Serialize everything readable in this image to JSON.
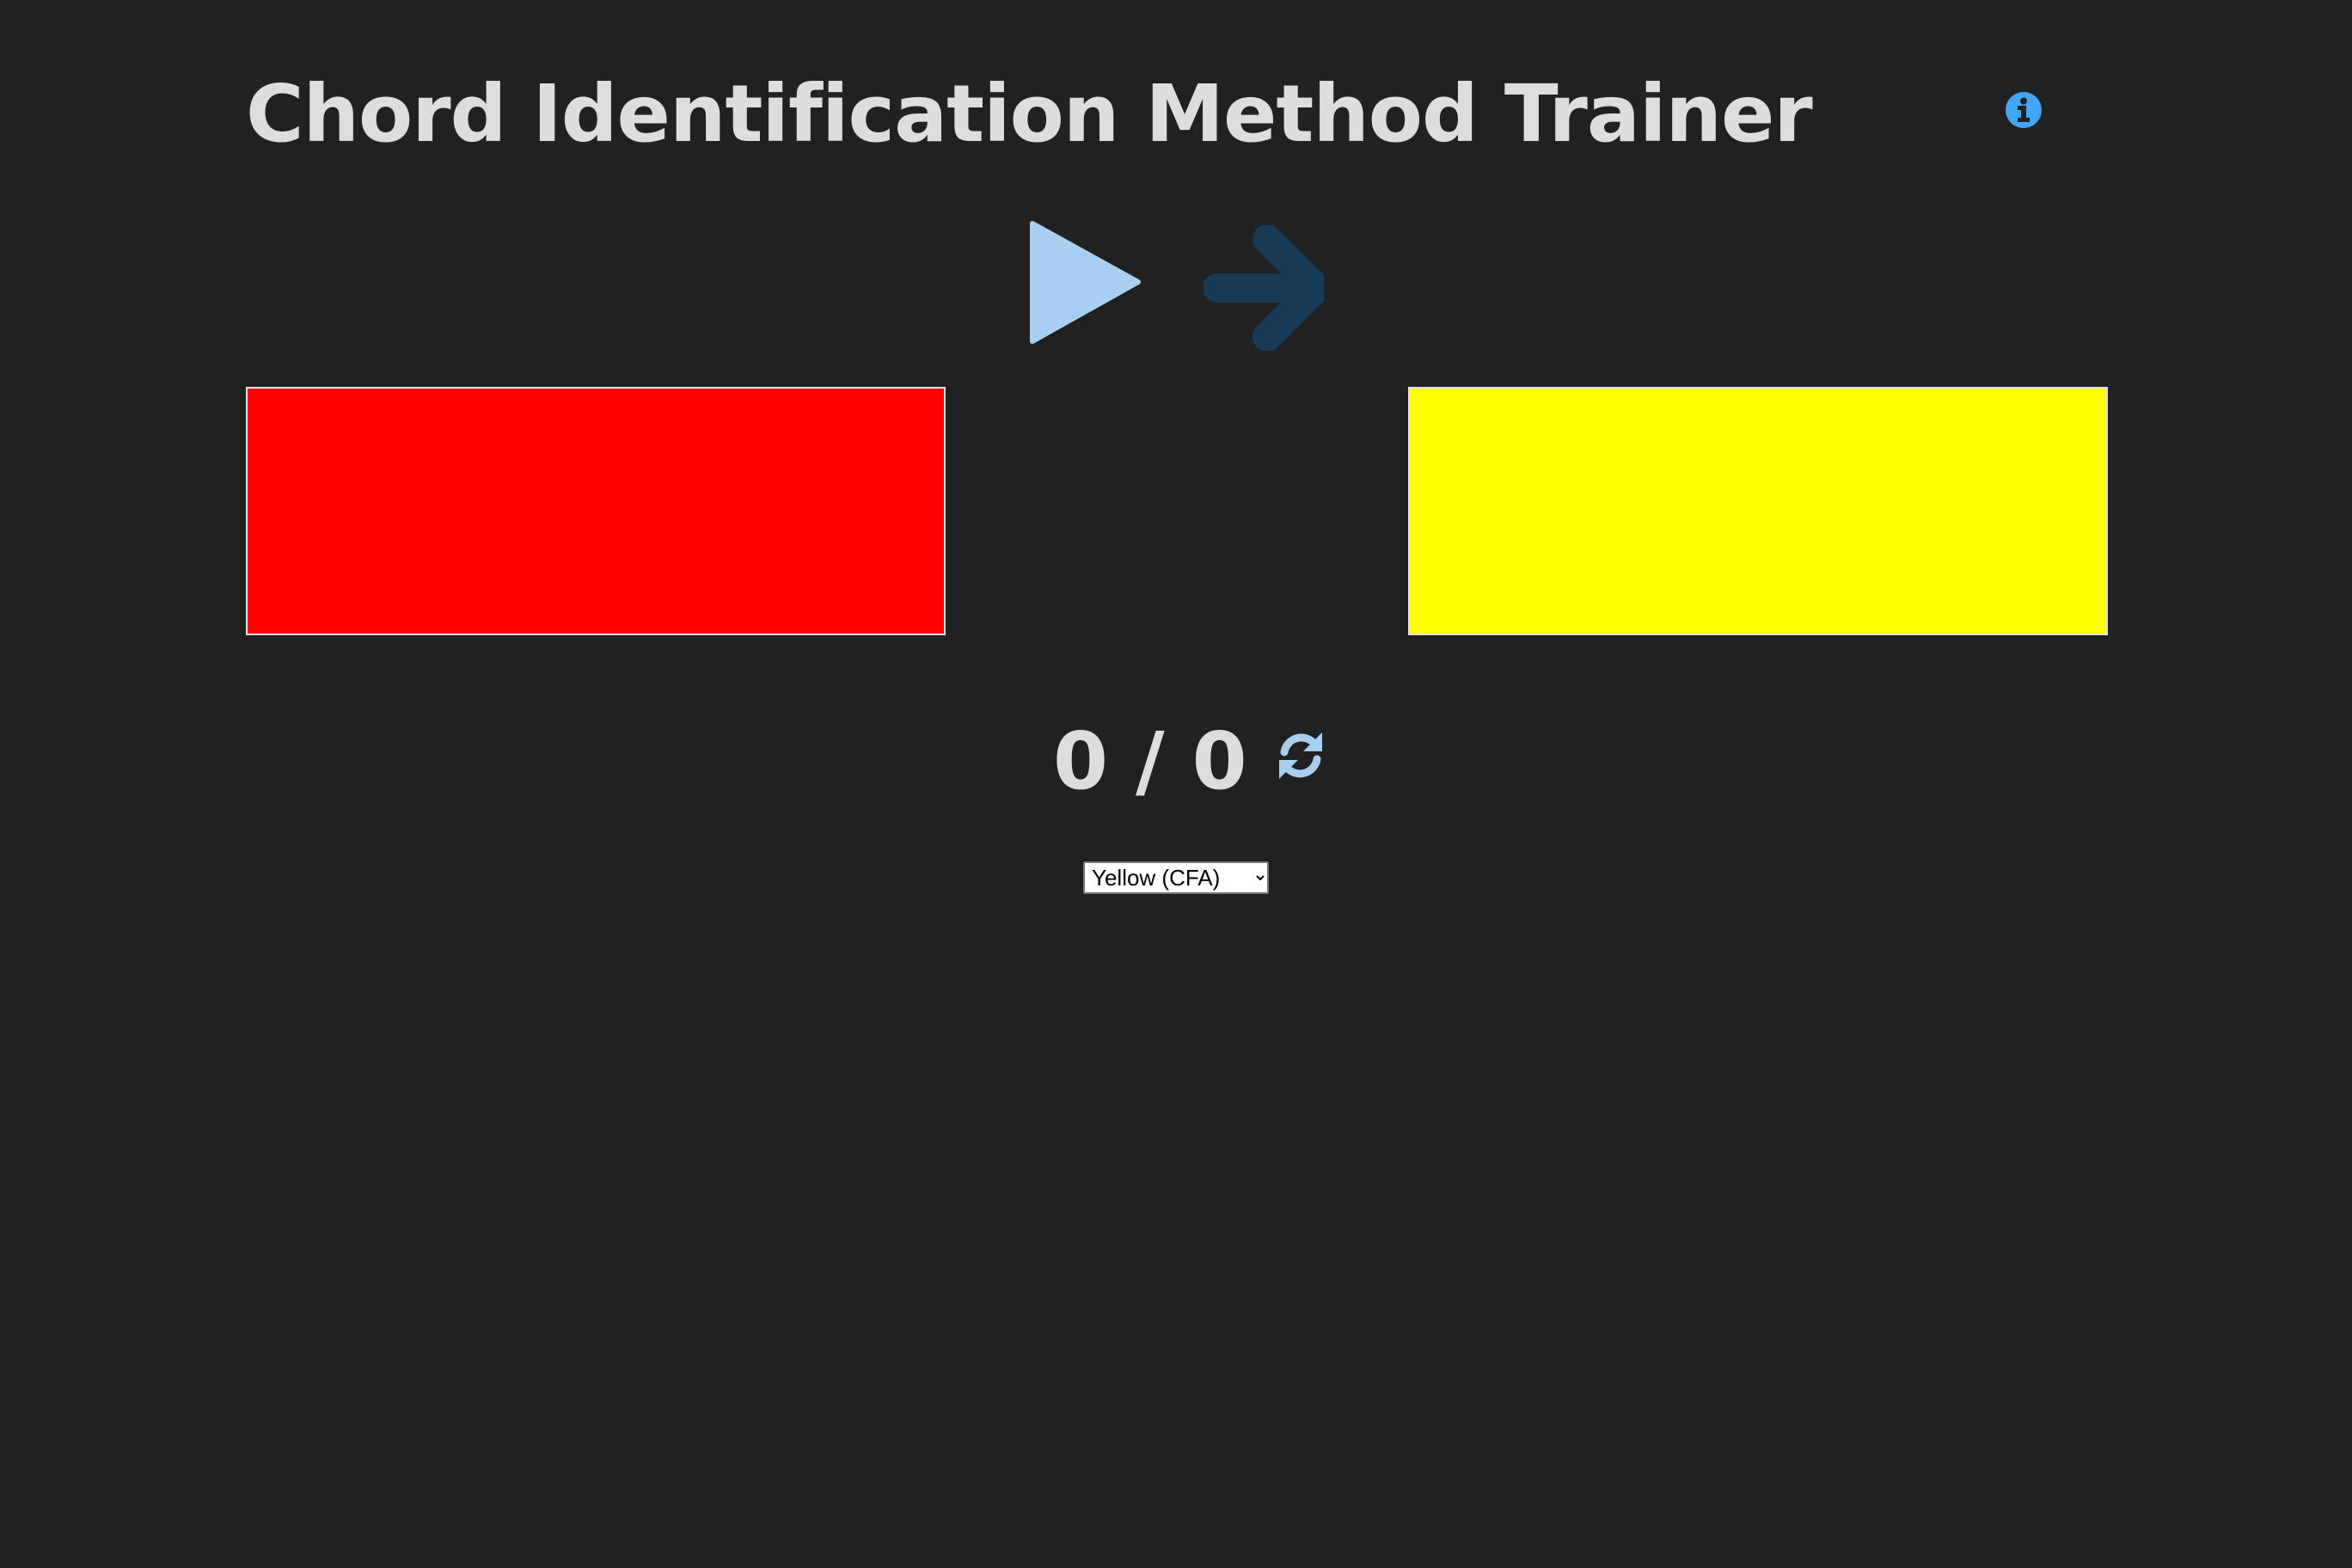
{
  "header": {
    "title": "Chord Identification Method Trainer",
    "info_icon": "info-circle-icon"
  },
  "controls": {
    "play_icon": "play-icon",
    "next_icon": "arrow-right-icon",
    "next_enabled": false
  },
  "choices": [
    {
      "color": "#ff0000"
    },
    {
      "color": "#ffff00"
    }
  ],
  "score": {
    "text": "0 / 0",
    "correct": 0,
    "total": 0,
    "reset_icon": "refresh-icon"
  },
  "color_select": {
    "selected": "Yellow (CFA)",
    "options": [
      "Yellow (CFA)"
    ]
  },
  "colors": {
    "background": "#212121",
    "title_text": "#dddddd",
    "info_icon": "#42a5f5",
    "play_icon": "#a8cff0",
    "next_icon_disabled": "#163a56",
    "reset_icon": "#a8cff0"
  }
}
